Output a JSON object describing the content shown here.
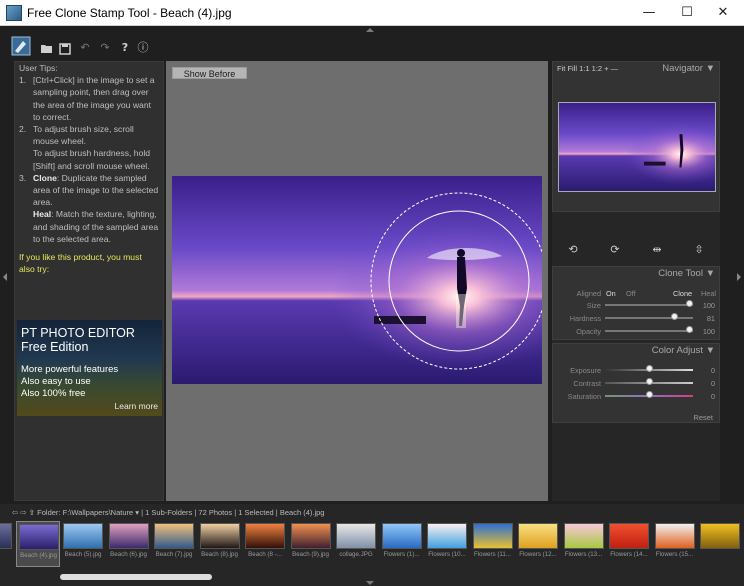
{
  "window": {
    "title": "Free Clone Stamp Tool - Beach (4).jpg",
    "minimize": "—",
    "maximize": "☐",
    "close": "✕"
  },
  "toolbar": {
    "open_icon": "folder-open-icon",
    "save_icon": "save-icon",
    "undo_icon": "undo-icon",
    "redo_icon": "redo-icon",
    "help": "?",
    "info": "ⓘ"
  },
  "tips": {
    "header": "User Tips:",
    "t1_num": "1.",
    "t1": "[Ctrl+Click] in the image to set a sampling point, then drag over the area of the image you want to correct.",
    "t2_num": "2.",
    "t2a": "To adjust brush size, scroll mouse wheel.",
    "t2b": "To adjust brush hardness, hold [Shift] and scroll mouse wheel.",
    "t3_num": "3.",
    "t3_bold": "Clone",
    "t3": ": Duplicate the sampled area of the image to the selected area.",
    "t4_bold": "Heal",
    "t4": ": Match the texture, lighting, and shading of the sampled area to the selected area.",
    "promo": "If you like this product, you must also try:",
    "ad_title": "PT PHOTO EDITOR",
    "ad_sub": "Free Edition",
    "ad_l1": "More powerful features",
    "ad_l2": "Also easy to use",
    "ad_l3": "Also 100% free",
    "ad_more": "Learn more"
  },
  "canvas": {
    "show_before": "Show Before"
  },
  "navigator": {
    "fit": "Fit",
    "fill": "Fill",
    "r11": "1:1",
    "r12": "1:2",
    "zoom_in": "+",
    "zoom_out": "—",
    "title": "Navigator",
    "collapse": "▼"
  },
  "clone_tool": {
    "title": "Clone Tool",
    "collapse": "▼",
    "aligned": "Aligned",
    "on": "On",
    "off": "Off",
    "clone": "Clone",
    "heal": "Heal",
    "size_label": "Size",
    "size": 100,
    "hardness_label": "Hardness",
    "hardness": 81,
    "opacity_label": "Opacity",
    "opacity": 100
  },
  "color_adjust": {
    "title": "Color Adjust",
    "collapse": "▼",
    "exposure_label": "Exposure",
    "exposure": 0,
    "contrast_label": "Contrast",
    "contrast": 0,
    "saturation_label": "Saturation",
    "saturation": 0,
    "reset": "Reset"
  },
  "filebar": {
    "folder_label": "Folder:",
    "path": "F:\\Wallpapers\\Nature ▾",
    "info": "| 1 Sub-Folders | 72 Photos | 1 Selected | Beach (4).jpg"
  },
  "thumbnails": [
    {
      "name": "jpg",
      "c1": "#6b6f9a",
      "c2": "#2a2f55"
    },
    {
      "name": "Beach (4).jpg",
      "c1": "#7a6bd0",
      "c2": "#2a1f6a"
    },
    {
      "name": "Beach (5).jpg",
      "c1": "#9ec8f0",
      "c2": "#2f6fb0"
    },
    {
      "name": "Beach (6).jpg",
      "c1": "#e0a0c0",
      "c2": "#3a2a6a"
    },
    {
      "name": "Beach (7).jpg",
      "c1": "#f0c080",
      "c2": "#305a8a"
    },
    {
      "name": "Beach (8).jpg",
      "c1": "#f0d0a0",
      "c2": "#201818"
    },
    {
      "name": "Beach (8 -...",
      "c1": "#f08040",
      "c2": "#301008"
    },
    {
      "name": "Beach (9).jpg",
      "c1": "#f09050",
      "c2": "#402030"
    },
    {
      "name": "collage.JPG",
      "c1": "#e8e8e8",
      "c2": "#8090a8"
    },
    {
      "name": "Flowers (1)...",
      "c1": "#90c8f8",
      "c2": "#2a6ac0"
    },
    {
      "name": "Flowers (10...",
      "c1": "#f8f0f0",
      "c2": "#40a0e0"
    },
    {
      "name": "Flowers (11...",
      "c1": "#3070d0",
      "c2": "#e8c030"
    },
    {
      "name": "Flowers (12...",
      "c1": "#f8e080",
      "c2": "#e0a020"
    },
    {
      "name": "Flowers (13...",
      "c1": "#f8c8d8",
      "c2": "#a8c840"
    },
    {
      "name": "Flowers (14...",
      "c1": "#f05030",
      "c2": "#c02010"
    },
    {
      "name": "Flowers (15...",
      "c1": "#f0f0f0",
      "c2": "#e06020"
    },
    {
      "name": "",
      "c1": "#f0c020",
      "c2": "#806010"
    }
  ]
}
